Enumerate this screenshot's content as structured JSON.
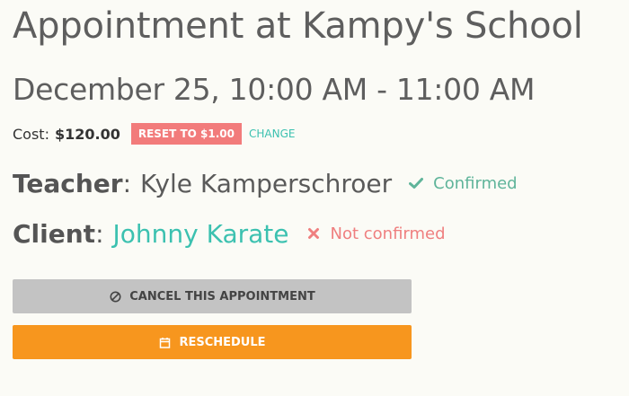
{
  "header": {
    "title": "Appointment at Kampy's School",
    "datetime": "December 25, 10:00 AM - 11:00 AM"
  },
  "cost": {
    "label": "Cost:",
    "value": "$120.00",
    "reset_label": "RESET TO $1.00",
    "change_label": "CHANGE"
  },
  "teacher": {
    "role_label": "Teacher",
    "name": "Kyle Kamperschroer",
    "status_text": "Confirmed",
    "status_icon": "checkmark-icon",
    "status_color": "#5fb49a"
  },
  "client": {
    "role_label": "Client",
    "name": "Johnny Karate",
    "status_text": "Not confirmed",
    "status_icon": "x-icon",
    "status_color": "#ef7f7f"
  },
  "actions": {
    "cancel_label": "CANCEL THIS APPOINTMENT",
    "cancel_icon": "cancel-circle-icon",
    "reschedule_label": "RESCHEDULE",
    "reschedule_icon": "calendar-icon"
  },
  "colors": {
    "accent": "#3cc1b0",
    "reset_badge": "#f27b7b",
    "cancel_button": "#c3c3c3",
    "reschedule_button": "#f7961e",
    "background": "#fbfbf6"
  }
}
